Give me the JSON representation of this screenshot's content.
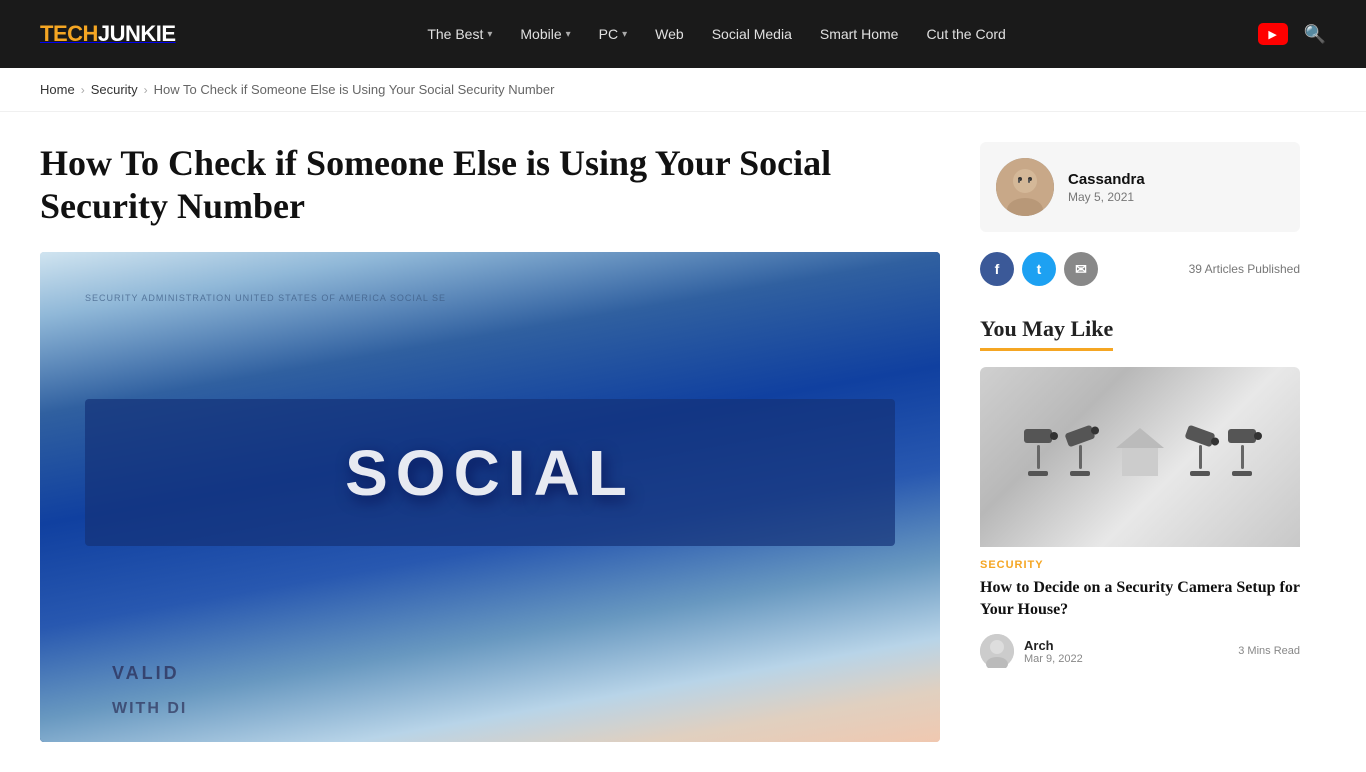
{
  "header": {
    "logo": {
      "tech": "TECH",
      "junkie": "JUNKIE"
    },
    "nav": [
      {
        "label": "The Best",
        "has_dropdown": true
      },
      {
        "label": "Mobile",
        "has_dropdown": true
      },
      {
        "label": "PC",
        "has_dropdown": true
      },
      {
        "label": "Web",
        "has_dropdown": false
      },
      {
        "label": "Social Media",
        "has_dropdown": false
      },
      {
        "label": "Smart Home",
        "has_dropdown": false
      },
      {
        "label": "Cut the Cord",
        "has_dropdown": false
      }
    ]
  },
  "breadcrumb": {
    "home": "Home",
    "security": "Security",
    "current": "How To Check if Someone Else is Using Your Social Security Number"
  },
  "article": {
    "title": "How To Check if Someone Else is Using Your Social Security Number",
    "image_alt": "Social Security Card close-up"
  },
  "sidebar": {
    "author": {
      "name": "Cassandra",
      "date": "May 5, 2021",
      "articles_count": "39 Articles Published"
    },
    "you_may_like": {
      "heading": "You May Like",
      "card": {
        "category": "SECURITY",
        "title": "How to Decide on a Security Camera Setup for Your House?",
        "author": "Arch",
        "date": "Mar 9, 2022",
        "read_time": "3 Mins Read"
      }
    }
  }
}
